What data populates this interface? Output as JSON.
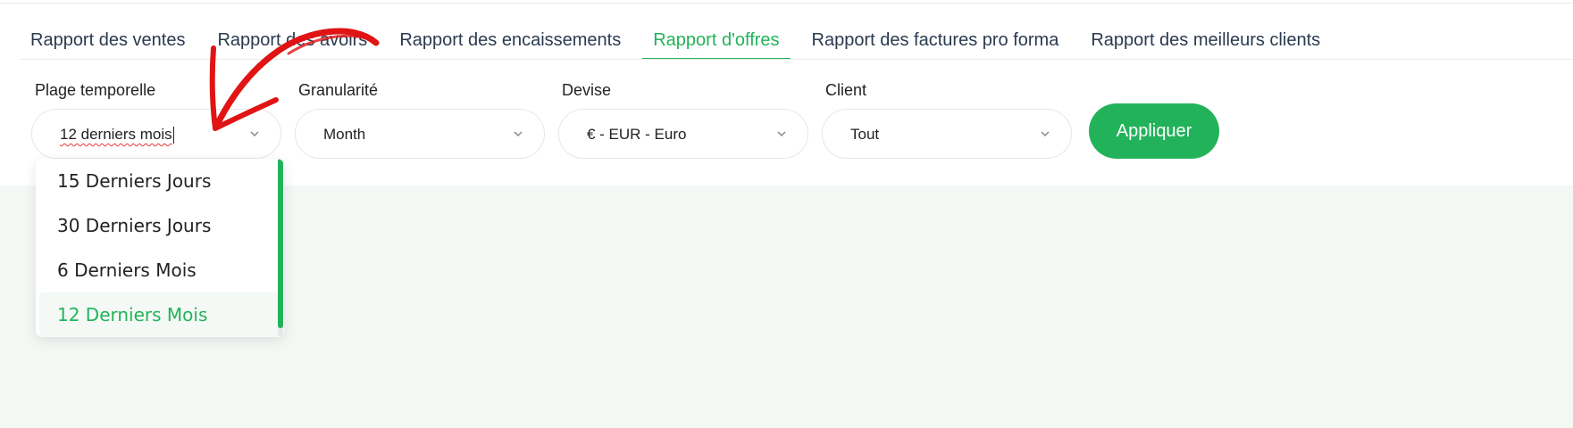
{
  "tabs": [
    {
      "label": "Rapport des ventes",
      "active": false
    },
    {
      "label": "Rapport des avoirs",
      "active": false
    },
    {
      "label": "Rapport des encaissements",
      "active": false
    },
    {
      "label": "Rapport d'offres",
      "active": true
    },
    {
      "label": "Rapport des factures pro forma",
      "active": false
    },
    {
      "label": "Rapport des meilleurs clients",
      "active": false
    }
  ],
  "filters": {
    "time_range": {
      "label": "Plage temporelle",
      "value": "12 derniers mois"
    },
    "granularity": {
      "label": "Granularité",
      "value": "Month"
    },
    "currency": {
      "label": "Devise",
      "value": "€ - EUR - Euro"
    },
    "client": {
      "label": "Client",
      "value": "Tout"
    }
  },
  "apply_label": "Appliquer",
  "dropdown": {
    "options": [
      "15 Derniers Jours",
      "30 Derniers Jours",
      "6 Derniers Mois",
      "12 Derniers Mois"
    ],
    "selected_index": 3
  },
  "colors": {
    "accent": "#22b35a",
    "annotation": "#e01414",
    "background": "#f3f8f5"
  },
  "icons": {
    "select_caret": "chevron-down-icon",
    "annotation": "red-curved-arrow-icon"
  }
}
